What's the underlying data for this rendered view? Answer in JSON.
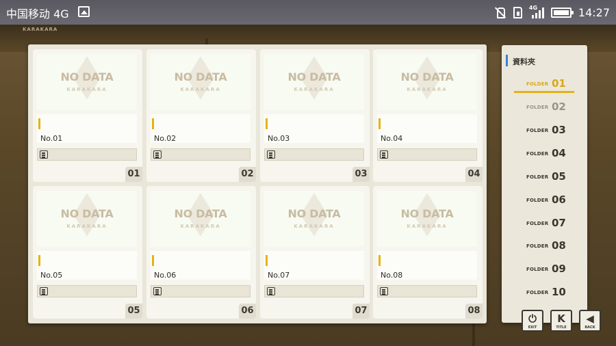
{
  "status_bar": {
    "carrier": "中国移动 4G",
    "network_tag": "4G",
    "time": "14:27",
    "icons": [
      "gallery-icon",
      "mute-icon",
      "sim-icon",
      "signal-icon",
      "battery-icon"
    ]
  },
  "background": {
    "logo_text": "KARAKARA"
  },
  "slots": [
    {
      "label": "No.01",
      "number": "01",
      "placeholder": "NO DATA",
      "placeholder_sub": "KARAKARA"
    },
    {
      "label": "No.02",
      "number": "02",
      "placeholder": "NO DATA",
      "placeholder_sub": "KARAKARA"
    },
    {
      "label": "No.03",
      "number": "03",
      "placeholder": "NO DATA",
      "placeholder_sub": "KARAKARA"
    },
    {
      "label": "No.04",
      "number": "04",
      "placeholder": "NO DATA",
      "placeholder_sub": "KARAKARA"
    },
    {
      "label": "No.05",
      "number": "05",
      "placeholder": "NO DATA",
      "placeholder_sub": "KARAKARA"
    },
    {
      "label": "No.06",
      "number": "06",
      "placeholder": "NO DATA",
      "placeholder_sub": "KARAKARA"
    },
    {
      "label": "No.07",
      "number": "07",
      "placeholder": "NO DATA",
      "placeholder_sub": "KARAKARA"
    },
    {
      "label": "No.08",
      "number": "08",
      "placeholder": "NO DATA",
      "placeholder_sub": "KARAKARA"
    }
  ],
  "folders": {
    "heading": "資料夾",
    "items": [
      {
        "word": "FOLDER",
        "number": "01",
        "state": "active"
      },
      {
        "word": "FOLDER",
        "number": "02",
        "state": "dim"
      },
      {
        "word": "FOLDER",
        "number": "03",
        "state": "normal"
      },
      {
        "word": "FOLDER",
        "number": "04",
        "state": "normal"
      },
      {
        "word": "FOLDER",
        "number": "05",
        "state": "normal"
      },
      {
        "word": "FOLDER",
        "number": "06",
        "state": "normal"
      },
      {
        "word": "FOLDER",
        "number": "07",
        "state": "normal"
      },
      {
        "word": "FOLDER",
        "number": "08",
        "state": "normal"
      },
      {
        "word": "FOLDER",
        "number": "09",
        "state": "normal"
      },
      {
        "word": "FOLDER",
        "number": "10",
        "state": "normal"
      }
    ]
  },
  "controls": {
    "exit_label": "EXIT",
    "title_label": "TITLE",
    "back_label": "BACK",
    "title_glyph": "K"
  },
  "colors": {
    "accent_yellow": "#e5b30f",
    "heading_blue": "#3d7fd6",
    "panel_bg": "#e9e6da"
  }
}
